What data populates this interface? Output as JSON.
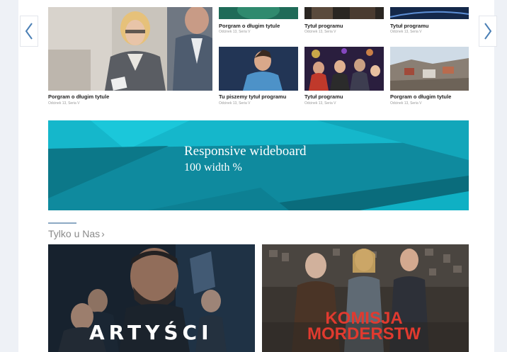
{
  "nav": {
    "prev_icon": "chevron-left-icon",
    "next_icon": "chevron-right-icon"
  },
  "carousel": {
    "top_row": [
      {
        "title": "Porgram o długim tytule",
        "subtitle": "Odcinek 13, Seria V"
      },
      {
        "title": "Tytuł programu",
        "subtitle": "Odcinek 13, Seria V"
      },
      {
        "title": "Tytuł programu",
        "subtitle": "Odcinek 13, Seria V"
      }
    ],
    "featured": {
      "title": "Porgram o długim tytule",
      "subtitle": "Odcinek 13, Seria V"
    },
    "bottom_row": [
      {
        "title": "Tu piszemy tytuł programu",
        "subtitle": "Odcinek 13, Seria V"
      },
      {
        "title": "Tytuł programu",
        "subtitle": "Odcinek 13, Seria V"
      },
      {
        "title": "Porgram o długim tytule",
        "subtitle": "Odcinek 13, Seria V"
      }
    ]
  },
  "wideboard": {
    "title": "Responsive wideboard",
    "subtitle": "100 width %"
  },
  "section": {
    "title": "Tylko u Nas",
    "chevron": "›"
  },
  "posters": [
    {
      "text": "ARTYŚCI",
      "text_color": "#ffffff"
    },
    {
      "line1": "KOMISJA",
      "line2": "MORDERSTW",
      "text_color": "#e13a2f"
    }
  ],
  "colors": {
    "accent_teal": "#13b4c8",
    "section_rule": "#8ca9c4"
  }
}
